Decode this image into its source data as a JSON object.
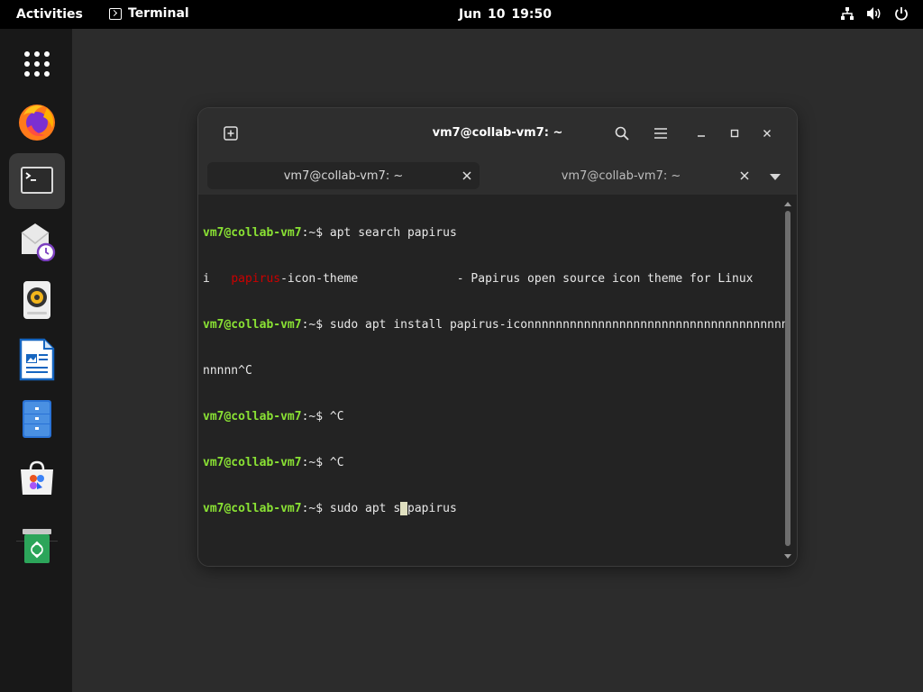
{
  "topbar": {
    "activities": "Activities",
    "app_name": "Terminal",
    "clock": "Jun 10  19:50",
    "tray_icons": [
      "network-icon",
      "volume-icon",
      "power-icon"
    ]
  },
  "dock": {
    "items": [
      {
        "name": "show-apps-icon"
      },
      {
        "name": "firefox-icon"
      },
      {
        "name": "terminal-icon",
        "active": true
      },
      {
        "name": "evolution-mail-icon"
      },
      {
        "name": "rhythmbox-icon"
      },
      {
        "name": "libreoffice-writer-icon"
      },
      {
        "name": "files-icon"
      },
      {
        "name": "software-center-icon"
      },
      {
        "name": "trash-icon"
      }
    ]
  },
  "window": {
    "title": "vm7@collab-vm7: ~",
    "tabs": [
      {
        "label": "vm7@collab-vm7: ~",
        "active": true
      },
      {
        "label": "vm7@collab-vm7: ~",
        "active": false
      }
    ]
  },
  "terminal": {
    "lines": [
      {
        "prompt": "vm7@collab-vm7",
        "path": ":~$ ",
        "text": "apt search papirus"
      },
      {
        "plain_prefix": "i   ",
        "highlight": "papirus",
        "plain_suffix": "-icon-theme              - Papirus open source icon theme for Linux"
      },
      {
        "prompt": "vm7@collab-vm7",
        "path": ":~$ ",
        "text": "sudo apt install papirus-iconnnnnnnnnnnnnnnnnnnnnnnnnnnnnnnnnnnnn"
      },
      {
        "plain": "nnnnn^C"
      },
      {
        "prompt": "vm7@collab-vm7",
        "path": ":~$ ",
        "text": "^C"
      },
      {
        "prompt": "vm7@collab-vm7",
        "path": ":~$ ",
        "text": "^C"
      },
      {
        "prompt": "vm7@collab-vm7",
        "path": ":~$ ",
        "text_before": "sudo apt s",
        "cursor": " ",
        "text_after": "papirus"
      }
    ]
  },
  "colors": {
    "prompt": "#8ae234",
    "highlight": "#cc0000",
    "terminal_bg": "#232323",
    "headerbar_bg": "#2e2e2e"
  }
}
